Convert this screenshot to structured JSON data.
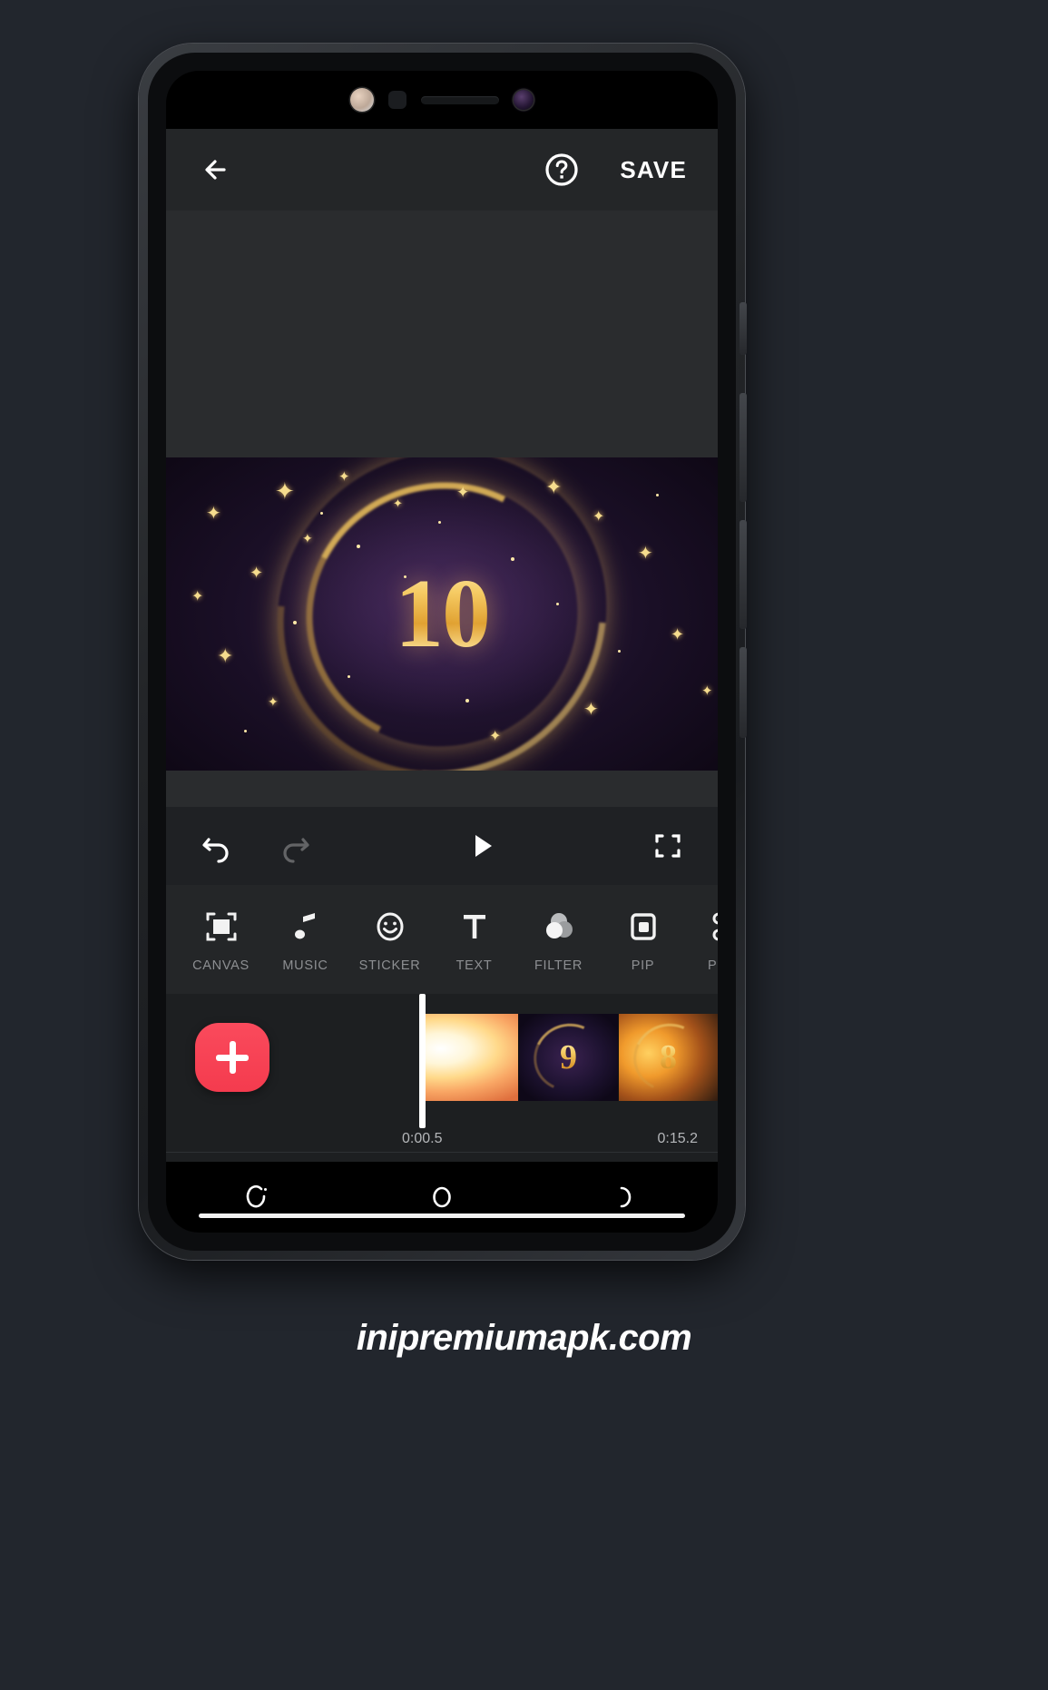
{
  "app": {
    "topbar": {
      "back_icon": "back-arrow-icon",
      "help_icon": "help-circle-icon",
      "save_label": "SAVE"
    },
    "preview": {
      "countdown_number": "10",
      "description": "gold glitter countdown video frame"
    },
    "playback": {
      "undo_icon": "undo-icon",
      "redo_icon": "redo-icon",
      "play_icon": "play-icon",
      "fullscreen_icon": "fullscreen-icon"
    },
    "tools": [
      {
        "label": "CANVAS",
        "icon": "canvas-icon"
      },
      {
        "label": "MUSIC",
        "icon": "music-note-icon"
      },
      {
        "label": "STICKER",
        "icon": "smiley-sticker-icon"
      },
      {
        "label": "TEXT",
        "icon": "text-t-icon"
      },
      {
        "label": "FILTER",
        "icon": "filter-circles-icon"
      },
      {
        "label": "PIP",
        "icon": "pip-icon"
      },
      {
        "label": "PREC",
        "icon": "scissors-icon"
      }
    ],
    "timeline": {
      "add_label": "+",
      "current_time": "0:00.5",
      "total_time": "0:15.2",
      "clips": [
        {
          "id": "clip-1",
          "number": ""
        },
        {
          "id": "clip-2",
          "number": "9"
        },
        {
          "id": "clip-3",
          "number": "8"
        }
      ]
    },
    "navbar": {
      "recents_icon": "recents-icon",
      "home_icon": "home-circle-icon",
      "back_icon": "nav-back-icon"
    }
  },
  "watermark": {
    "text": "inipremiumapk.com"
  },
  "colors": {
    "accent_red": "#fa4a5c",
    "topbar_bg": "#242628",
    "app_bg": "#1f2124",
    "timeline_bg": "#1d1f21",
    "label_gray": "#8d8f92",
    "gold": "#f3c95f"
  }
}
